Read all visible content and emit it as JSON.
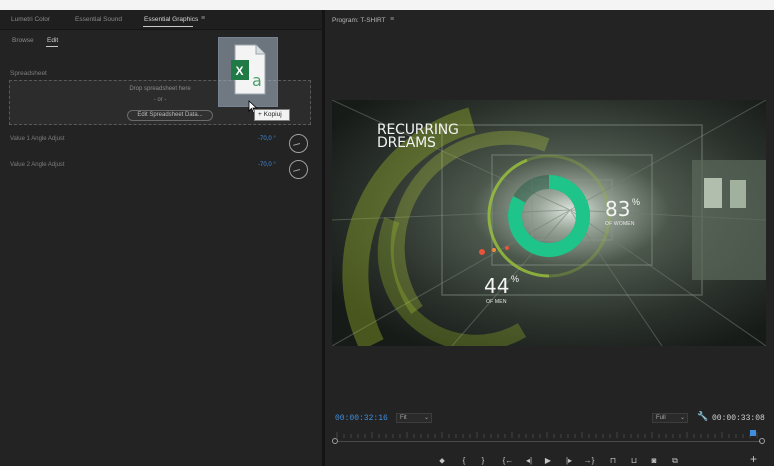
{
  "left_panel": {
    "tabs": [
      {
        "label": "Lumetri Color"
      },
      {
        "label": "Essential Sound"
      },
      {
        "label": "Essential Graphics"
      }
    ],
    "menu_icon": "≡",
    "subtabs": [
      {
        "label": "Browse"
      },
      {
        "label": "Edit"
      }
    ],
    "spreadsheet": {
      "section_label": "Spreadsheet",
      "drop_text": "Drop spreadsheet here",
      "or_text": "- or -",
      "edit_button": "Edit Spreadsheet Data..."
    },
    "params": [
      {
        "label": "Value 1 Angle Adjust",
        "value": "-70,0 °"
      },
      {
        "label": "Value 2 Angle Adjust",
        "value": "-70,0 °"
      }
    ],
    "drag": {
      "file_icon": "excel-file-icon",
      "copy_tooltip": "+ Kopiuj"
    }
  },
  "program_monitor": {
    "title": "Program: T-SHIRT",
    "menu_icon": "≡",
    "video": {
      "title_line1": "RECURRING",
      "title_line2": "DREAMS",
      "stat1": {
        "value": "83",
        "unit": "%",
        "label": "OF WOMEN",
        "fraction": 0.83
      },
      "stat2": {
        "value": "44",
        "unit": "%",
        "label": "OF MEN",
        "fraction": 0.44
      }
    },
    "timecode_current": "00:00:32:16",
    "zoom": "Fit",
    "resolution": "Full",
    "timecode_duration": "00:00:33:08",
    "colors": {
      "accent": "#3f8fe0",
      "ring_green": "#1fc48a"
    }
  },
  "controls": {
    "marker": "⬥",
    "in_point": "{",
    "out_point": "}",
    "go_to_in": "{←",
    "step_back": "◂|",
    "play": "▶",
    "step_forward": "|▸",
    "go_to_out": "→}",
    "lift": "⊓",
    "extract": "⊔",
    "export_frame": "◙",
    "compare": "⧉",
    "add": "+"
  }
}
